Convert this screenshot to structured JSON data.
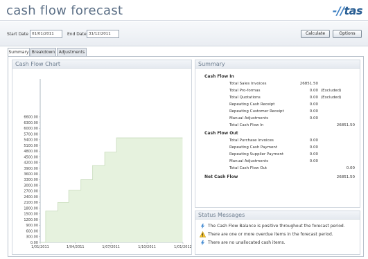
{
  "header": {
    "title": "cash flow forecast",
    "logo": "tas"
  },
  "toolbar": {
    "start_label": "Start Date",
    "start_value": "01/01/2011",
    "end_label": "End Date",
    "end_value": "31/12/2011",
    "calculate_label": "Calculate",
    "options_label": "Options"
  },
  "tabs": [
    {
      "label": "Summary",
      "active": true
    },
    {
      "label": "Breakdown",
      "active": false
    },
    {
      "label": "Adjustments",
      "active": false
    }
  ],
  "chart_panel": {
    "title": "Cash Flow Chart"
  },
  "chart_data": {
    "type": "area",
    "title": "",
    "xlabel": "",
    "ylabel": "",
    "ylim": [
      0,
      8600
    ],
    "y_ticks": [
      "0.00",
      "300.00",
      "600.00",
      "900.00",
      "1200.00",
      "1500.00",
      "1800.00",
      "2100.00",
      "2400.00",
      "2700.00",
      "3000.00",
      "3300.00",
      "3600.00",
      "3900.00",
      "4200.00",
      "4500.00",
      "4800.00",
      "5100.00",
      "5400.00",
      "5700.00",
      "6000.00",
      "6300.00",
      "6600.00"
    ],
    "x_ticks": [
      "1/01/2011",
      "1/04/2011",
      "1/07/2011",
      "1/10/2011",
      "1/01/2012"
    ],
    "series": [
      {
        "x": [
          "01/01/2011",
          "15/01/2011",
          "15/02/2011",
          "15/03/2011",
          "15/04/2011",
          "15/05/2011",
          "15/06/2011",
          "15/07/2011",
          "31/12/2011"
        ],
        "values": [
          0,
          1650,
          2100,
          2750,
          3300,
          4050,
          4750,
          5500,
          5500
        ]
      }
    ],
    "fill_color": "#e6f2de",
    "line_color": "#c8dcbc"
  },
  "summary_panel": {
    "title": "Summary",
    "inflow": {
      "heading": "Cash Flow In",
      "rows": [
        {
          "label": "Total Sales Invoices",
          "value": "26851.50",
          "note": ""
        },
        {
          "label": "Total Pro-formas",
          "value": "0.00",
          "note": "(Excluded)"
        },
        {
          "label": "Total Quotations",
          "value": "0.00",
          "note": "(Excluded)"
        },
        {
          "label": "Repeating Cash Receipt",
          "value": "0.00",
          "note": ""
        },
        {
          "label": "Repeating Customer Receipt",
          "value": "0.00",
          "note": ""
        },
        {
          "label": "Manual Adjustments",
          "value": "0.00",
          "note": ""
        }
      ],
      "total_label": "Total Cash Flow In",
      "total_value": "26851.50"
    },
    "outflow": {
      "heading": "Cash Flow Out",
      "rows": [
        {
          "label": "Total Purchase Invoices",
          "value": "0.00"
        },
        {
          "label": "Repeating Cash Payment",
          "value": "0.00"
        },
        {
          "label": "Repeating Supplier Payment",
          "value": "0.00"
        },
        {
          "label": "Manual Adjustments",
          "value": "0.00"
        }
      ],
      "total_label": "Total Cash Flow Out",
      "total_value": "0.00"
    },
    "net_label": "Net Cash Flow",
    "net_value": "26851.50"
  },
  "status_panel": {
    "title": "Status Messages",
    "messages": [
      {
        "icon": "info-icon",
        "text": "The Cash Flow Balance is positive throughout the forecast period."
      },
      {
        "icon": "warning-icon",
        "text": "There are one or more overdue items in the forecast period."
      },
      {
        "icon": "info-icon",
        "text": "There are no unallocated cash items."
      }
    ]
  }
}
